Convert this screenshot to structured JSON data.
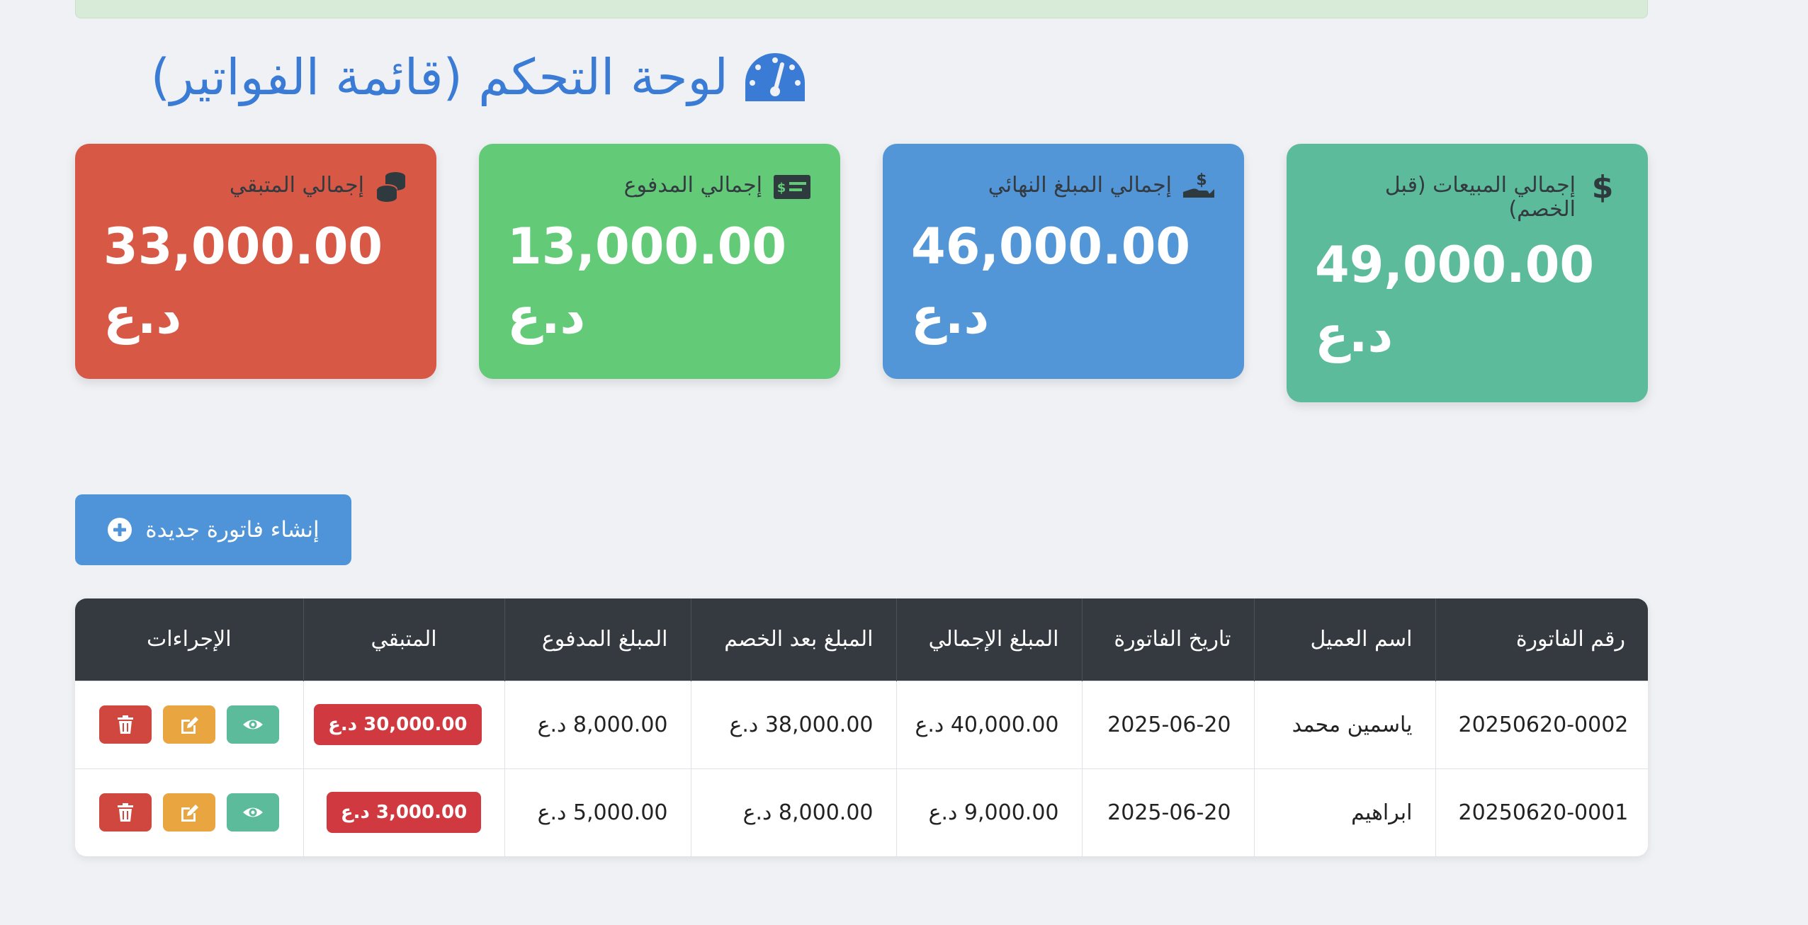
{
  "page_title": "لوحة التحكم (قائمة الفواتير)",
  "colors": {
    "title": "#3a7bd5",
    "card_sales": "#5bbb9a",
    "card_final": "#5296d8",
    "card_paid": "#63cb78",
    "card_remaining": "#d85846",
    "table_header": "#343a40",
    "badge_remaining": "#d0393f"
  },
  "cards": [
    {
      "label": "إجمالي المبيعات (قبل الخصم)",
      "amount": "49,000.00",
      "currency": "د.ع",
      "icon": "dollar-icon"
    },
    {
      "label": "إجمالي المبلغ النهائي",
      "amount": "46,000.00",
      "currency": "د.ع",
      "icon": "hand-holding-dollar-icon"
    },
    {
      "label": "إجمالي المدفوع",
      "amount": "13,000.00",
      "currency": "د.ع",
      "icon": "money-check-icon"
    },
    {
      "label": "إجمالي المتبقي",
      "amount": "33,000.00",
      "currency": "د.ع",
      "icon": "coins-icon"
    }
  ],
  "create_button": {
    "label": "إنشاء فاتورة جديدة",
    "icon": "plus-circle-icon"
  },
  "table": {
    "headers": [
      "رقم الفاتورة",
      "اسم العميل",
      "تاريخ الفاتورة",
      "المبلغ الإجمالي",
      "المبلغ بعد الخصم",
      "المبلغ المدفوع",
      "المتبقي",
      "الإجراءات"
    ],
    "rows": [
      {
        "invoice_no": "20250620-0002",
        "customer": "ياسمين محمد",
        "date": "2025-06-20",
        "total": "40,000.00 د.ع",
        "after_discount": "38,000.00 د.ع",
        "paid": "8,000.00 د.ع",
        "remaining": "30,000.00 د.ع"
      },
      {
        "invoice_no": "20250620-0001",
        "customer": "ابراهيم",
        "date": "2025-06-20",
        "total": "9,000.00 د.ع",
        "after_discount": "8,000.00 د.ع",
        "paid": "5,000.00 د.ع",
        "remaining": "3,000.00 د.ع"
      }
    ],
    "action_icons": [
      "eye-icon",
      "edit-icon",
      "trash-icon"
    ]
  }
}
